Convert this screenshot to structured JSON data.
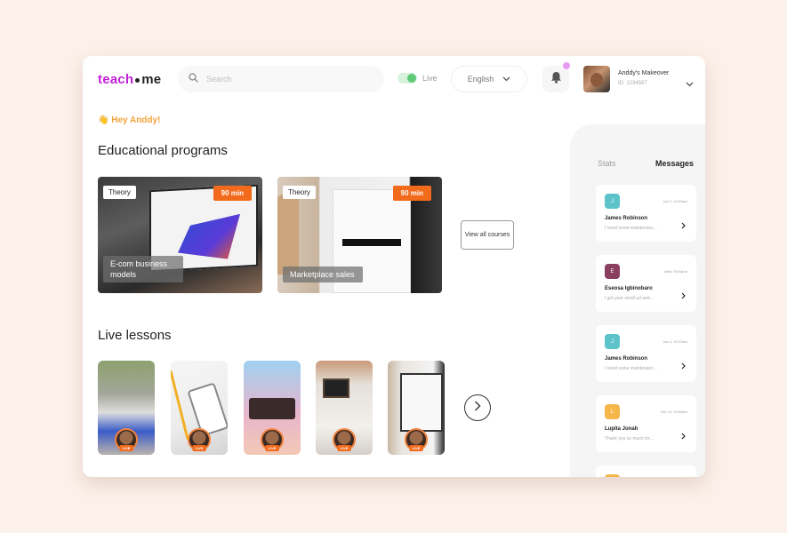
{
  "brand": {
    "pre": "teach",
    "post": "me"
  },
  "search": {
    "placeholder": "Search"
  },
  "live_toggle": {
    "label": "Live",
    "on": true
  },
  "language": {
    "selected": "English"
  },
  "user": {
    "name": "Anddy's Makeover",
    "id": "ID: 1234567"
  },
  "greeting": "👋 Hey Anddy!",
  "programs": {
    "heading": "Educational programs",
    "items": [
      {
        "tag": "Theory",
        "duration": "90 min",
        "title": "E-com business models"
      },
      {
        "tag": "Theory",
        "duration": "90 min",
        "title": "Marketplace sales"
      }
    ],
    "view_all": "View all courses"
  },
  "live_lessons": {
    "heading": "Live lessons",
    "badge": "LIVE",
    "items": [
      {
        "badge": "LIVE"
      },
      {
        "badge": "LIVE"
      },
      {
        "badge": "LIVE"
      },
      {
        "badge": "LIVE"
      },
      {
        "badge": "LIVE"
      }
    ]
  },
  "sidebar": {
    "tabs": [
      {
        "label": "Stats",
        "active": false
      },
      {
        "label": "Messages",
        "active": true
      }
    ],
    "messages": [
      {
        "initial": "J",
        "color": "#5cc3c9",
        "time": "Jan 2, 10:23am",
        "name": "James Robinson",
        "text": "I need some maintenanc..."
      },
      {
        "initial": "E",
        "color": "#8a3f5e",
        "time": "Wed, 06:00pm",
        "name": "Eseosa Igbinobaro",
        "text": "I got your small ad and..."
      },
      {
        "initial": "J",
        "color": "#5cc3c9",
        "time": "Jan 2, 10:23am",
        "name": "James Robinson",
        "text": "I need some maintenanc..."
      },
      {
        "initial": "L",
        "color": "#f5b64a",
        "time": "Feb 13, 06:56am",
        "name": "Lupita Jonah",
        "text": "Thank you so much for..."
      }
    ]
  }
}
